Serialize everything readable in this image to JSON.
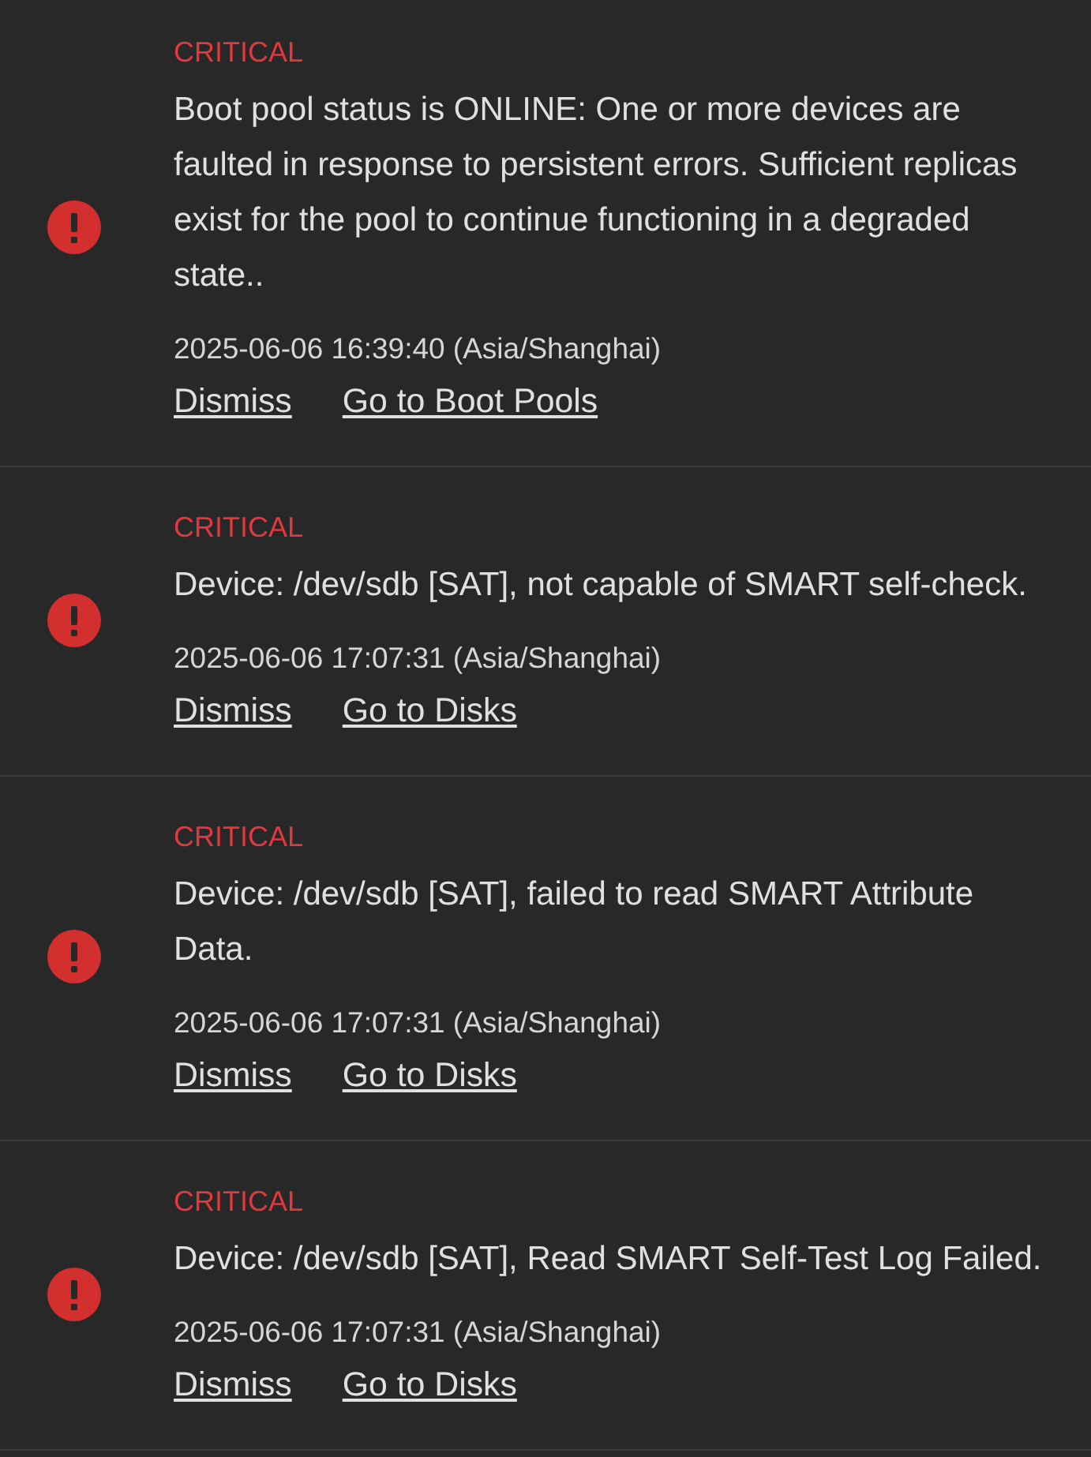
{
  "alerts": [
    {
      "severity": "CRITICAL",
      "message": "Boot pool status is ONLINE: One or more devices are faulted in response to persistent errors. Sufficient replicas exist for the pool to continue functioning in a degraded state..",
      "timestamp": "2025-06-06 16:39:40 (Asia/Shanghai)",
      "actions": [
        "Dismiss",
        "Go to Boot Pools"
      ]
    },
    {
      "severity": "CRITICAL",
      "message": "Device: /dev/sdb [SAT], not capable of SMART self-check.",
      "timestamp": "2025-06-06 17:07:31 (Asia/Shanghai)",
      "actions": [
        "Dismiss",
        "Go to Disks"
      ]
    },
    {
      "severity": "CRITICAL",
      "message": "Device: /dev/sdb [SAT], failed to read SMART Attribute Data.",
      "timestamp": "2025-06-06 17:07:31 (Asia/Shanghai)",
      "actions": [
        "Dismiss",
        "Go to Disks"
      ]
    },
    {
      "severity": "CRITICAL",
      "message": "Device: /dev/sdb [SAT], Read SMART Self-Test Log Failed.",
      "timestamp": "2025-06-06 17:07:31 (Asia/Shanghai)",
      "actions": [
        "Dismiss",
        "Go to Disks"
      ]
    }
  ]
}
